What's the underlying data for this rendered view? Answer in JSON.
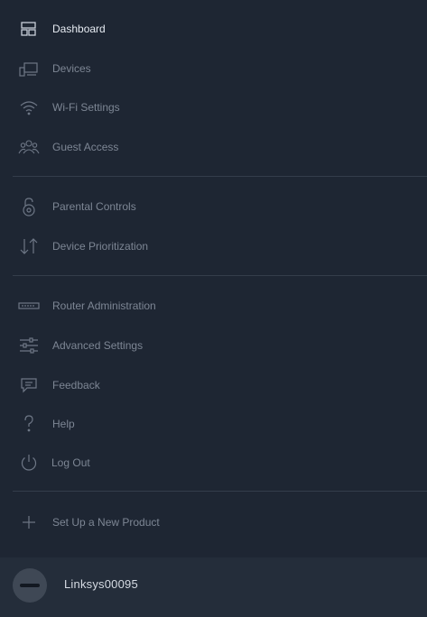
{
  "menu": {
    "items": [
      {
        "label": "Dashboard",
        "icon": "dashboard-icon"
      },
      {
        "label": "Devices",
        "icon": "devices-icon"
      },
      {
        "label": "Wi-Fi Settings",
        "icon": "wifi-icon"
      },
      {
        "label": "Guest Access",
        "icon": "guests-icon"
      },
      {
        "label": "Parental Controls",
        "icon": "lock-icon"
      },
      {
        "label": "Device Prioritization",
        "icon": "up-down-arrows-icon"
      },
      {
        "label": "Router Administration",
        "icon": "router-icon"
      },
      {
        "label": "Advanced Settings",
        "icon": "sliders-icon"
      },
      {
        "label": "Feedback",
        "icon": "speech-bubble-icon"
      },
      {
        "label": "Help",
        "icon": "question-mark-icon"
      },
      {
        "label": "Log Out",
        "icon": "power-icon"
      },
      {
        "label": "Set Up a New Product",
        "icon": "plus-icon"
      }
    ],
    "active": "Dashboard"
  },
  "footer": {
    "network_name": "Linksys00095"
  },
  "colors": {
    "background": "#1e2633",
    "footer_background": "#242d3a",
    "label": "#7d8694",
    "active_label": "#e6ebf2",
    "divider": "#343d4b"
  }
}
